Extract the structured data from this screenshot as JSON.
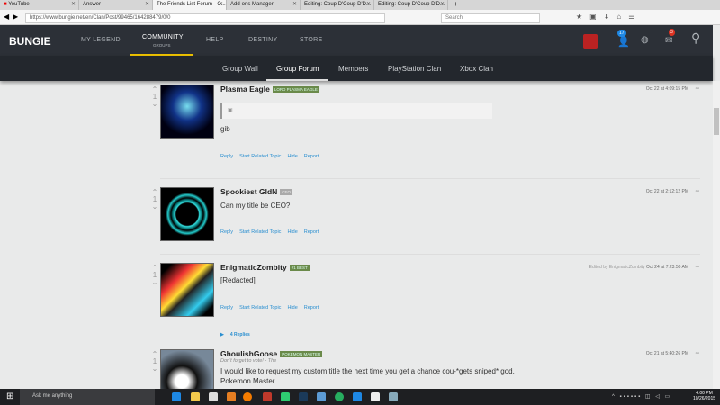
{
  "browser": {
    "tabs": [
      {
        "label": "YouTube"
      },
      {
        "label": "Answer"
      },
      {
        "label": "The Friends List Forum - C..."
      },
      {
        "label": "Add-ons Manager"
      },
      {
        "label": "Editing: Coup D'Coup D'D..."
      },
      {
        "label": "Editing: Coup D'Coup D'D..."
      }
    ],
    "url": "https://www.bungie.net/en/Clan/Post/99465/164288479/0/0",
    "search_placeholder": "Search"
  },
  "site": {
    "logo": "BUNGIE",
    "nav": [
      "MY LEGEND",
      "COMMUNITY",
      "HELP",
      "DESTINY",
      "STORE"
    ],
    "community_sub": "GROUPS",
    "notif_count": "17",
    "mail_count": "3",
    "subnav": [
      "Group Wall",
      "Group Forum",
      "Members",
      "PlayStation Clan",
      "Xbox Clan"
    ]
  },
  "actions": {
    "reply": "Reply",
    "related": "Start Related Topic",
    "hide": "Hide",
    "report": "Report"
  },
  "posts": [
    {
      "votes": "1",
      "name": "Plasma Eagle",
      "badge": "LORD PLASMA EAGLE",
      "time": "Oct 22 at 4:09:15 PM",
      "body": "gib"
    },
    {
      "votes": "1",
      "name": "Spookiest GldN",
      "badge": "CEO",
      "time": "Oct 22 at 2:12:12 PM",
      "body": "Can my title be CEO?"
    },
    {
      "votes": "1",
      "name": "EnigmaticZombity",
      "badge": "#1 BEST",
      "time": "Oct 24 at 7:23:50 AM",
      "edited": "Edited by EnigmaticZombity",
      "body": "[Redacted]",
      "replies": "4 Replies"
    },
    {
      "votes": "1",
      "name": "GhoulishGoose",
      "badge": "POKEMON MASTER",
      "time": "Oct 21 at 5:40:26 PM",
      "motto": "Don't forget to vote! - The",
      "body": "I would like to request my custom title the next time you get a chance cou-*gets sniped* god.",
      "body2": "Pokemon Master"
    }
  ],
  "taskbar": {
    "search": "Ask me anything",
    "time": "4:00 PM",
    "date": "10/26/2015"
  }
}
